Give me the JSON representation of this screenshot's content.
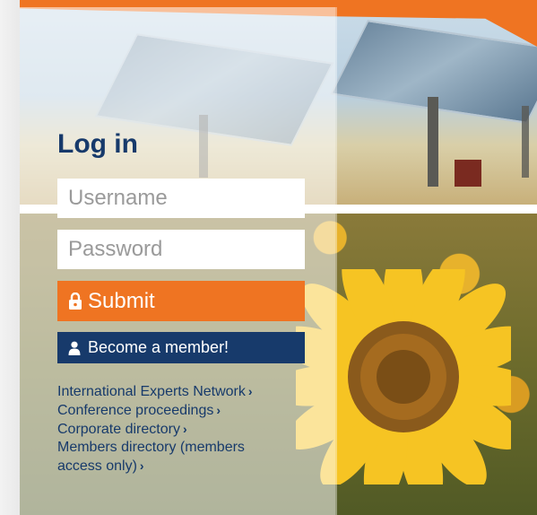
{
  "login": {
    "title": "Log in",
    "username_placeholder": "Username",
    "password_placeholder": "Password",
    "submit_label": "Submit",
    "member_label": "Become a member!"
  },
  "links": [
    {
      "label": "International Experts Network"
    },
    {
      "label": "Conference proceedings"
    },
    {
      "label": "Corporate directory"
    },
    {
      "label": "Members directory (members access only)"
    }
  ],
  "icons": {
    "submit": "lock-icon",
    "member": "user-icon",
    "link_chevron": "chevron-right-icon"
  },
  "colors": {
    "accent": "#ef7422",
    "brand": "#173a6b"
  }
}
